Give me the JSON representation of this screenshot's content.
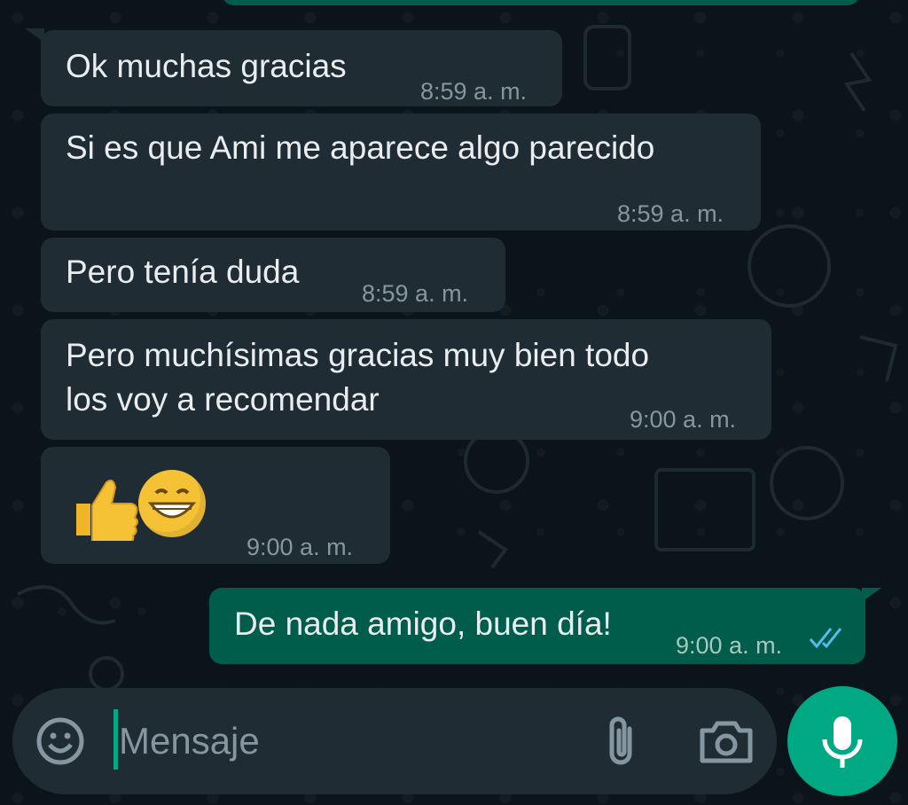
{
  "messages": [
    {
      "dir": "in",
      "text": "Ok muchas gracias",
      "time": "8:59 a. m."
    },
    {
      "dir": "in",
      "text": "Si es que Ami me aparece algo parecido",
      "time": "8:59 a. m."
    },
    {
      "dir": "in",
      "text": "Pero tenía duda",
      "time": "8:59 a. m."
    },
    {
      "dir": "in",
      "text_line1": "Pero muchísimas gracias muy bien todo",
      "text_line2": "los voy a recomendar",
      "time": "9:00 a. m."
    },
    {
      "dir": "in",
      "emoji": [
        "thumbs-up",
        "grinning-face"
      ],
      "time": "9:00 a. m."
    },
    {
      "dir": "out",
      "text": "De nada amigo, buen día!",
      "time": "9:00 a. m.",
      "status": "read"
    }
  ],
  "composer": {
    "placeholder": "Mensaje"
  },
  "colors": {
    "background": "#0b141a",
    "incoming_bubble": "#202c33",
    "outgoing_bubble": "#005c4b",
    "accent": "#00a884",
    "read_ticks": "#53bdeb"
  },
  "icons": [
    "emoji-icon",
    "attach-icon",
    "camera-icon",
    "mic-icon",
    "double-check-icon"
  ]
}
